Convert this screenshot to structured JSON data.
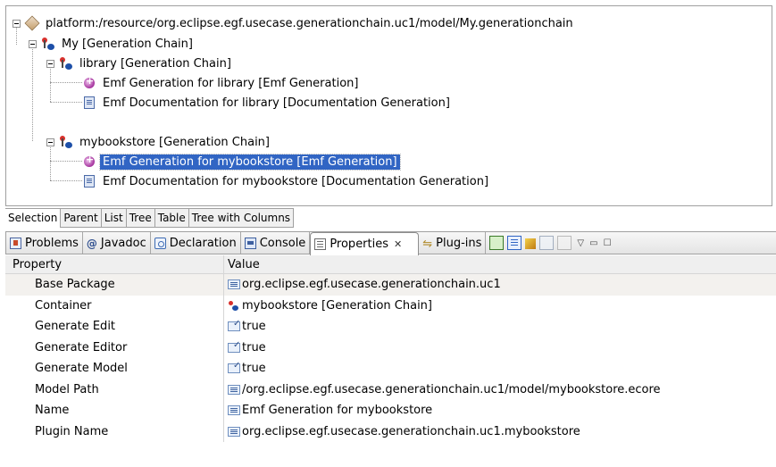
{
  "tree": {
    "root": "platform:/resource/org.eclipse.egf.usecase.generationchain.uc1/model/My.generationchain",
    "my": "My [Generation Chain]",
    "library": "library [Generation Chain]",
    "library_emf": "Emf Generation for library [Emf Generation]",
    "library_doc": "Emf Documentation for library [Documentation Generation]",
    "mybookstore": "mybookstore [Generation Chain]",
    "mybookstore_emf": "Emf Generation for mybookstore [Emf Generation]",
    "mybookstore_doc": "Emf Documentation for mybookstore [Documentation Generation]",
    "selected": "Emf Generation for mybookstore [Emf Generation]"
  },
  "editor_tabs": [
    "Selection",
    "Parent",
    "List",
    "Tree",
    "Table",
    "Tree with Columns"
  ],
  "view_tabs": {
    "problems": "Problems",
    "javadoc": "Javadoc",
    "declaration": "Declaration",
    "console": "Console",
    "properties": "Properties",
    "plugins": "Plug-ins",
    "javadoc_glyph": "@",
    "close_glyph": "✕",
    "plugins_glyph": "⇋",
    "menu_glyph": "▽",
    "min_glyph": "▭",
    "max_glyph": "☐"
  },
  "properties": {
    "header_property": "Property",
    "header_value": "Value",
    "rows": [
      {
        "name": "Base Package",
        "value": "org.eclipse.egf.usecase.generationchain.uc1"
      },
      {
        "name": "Container",
        "value": "mybookstore [Generation Chain]"
      },
      {
        "name": "Generate Edit",
        "value": "true"
      },
      {
        "name": "Generate Editor",
        "value": "true"
      },
      {
        "name": "Generate Model",
        "value": "true"
      },
      {
        "name": "Model Path",
        "value": "/org.eclipse.egf.usecase.generationchain.uc1/model/mybookstore.ecore"
      },
      {
        "name": "Name",
        "value": "Emf Generation for mybookstore"
      },
      {
        "name": "Plugin Name",
        "value": "org.eclipse.egf.usecase.generationchain.uc1.mybookstore"
      }
    ]
  },
  "colors": {
    "selection": "#3165c4",
    "alt_row": "#f3f1ee"
  }
}
